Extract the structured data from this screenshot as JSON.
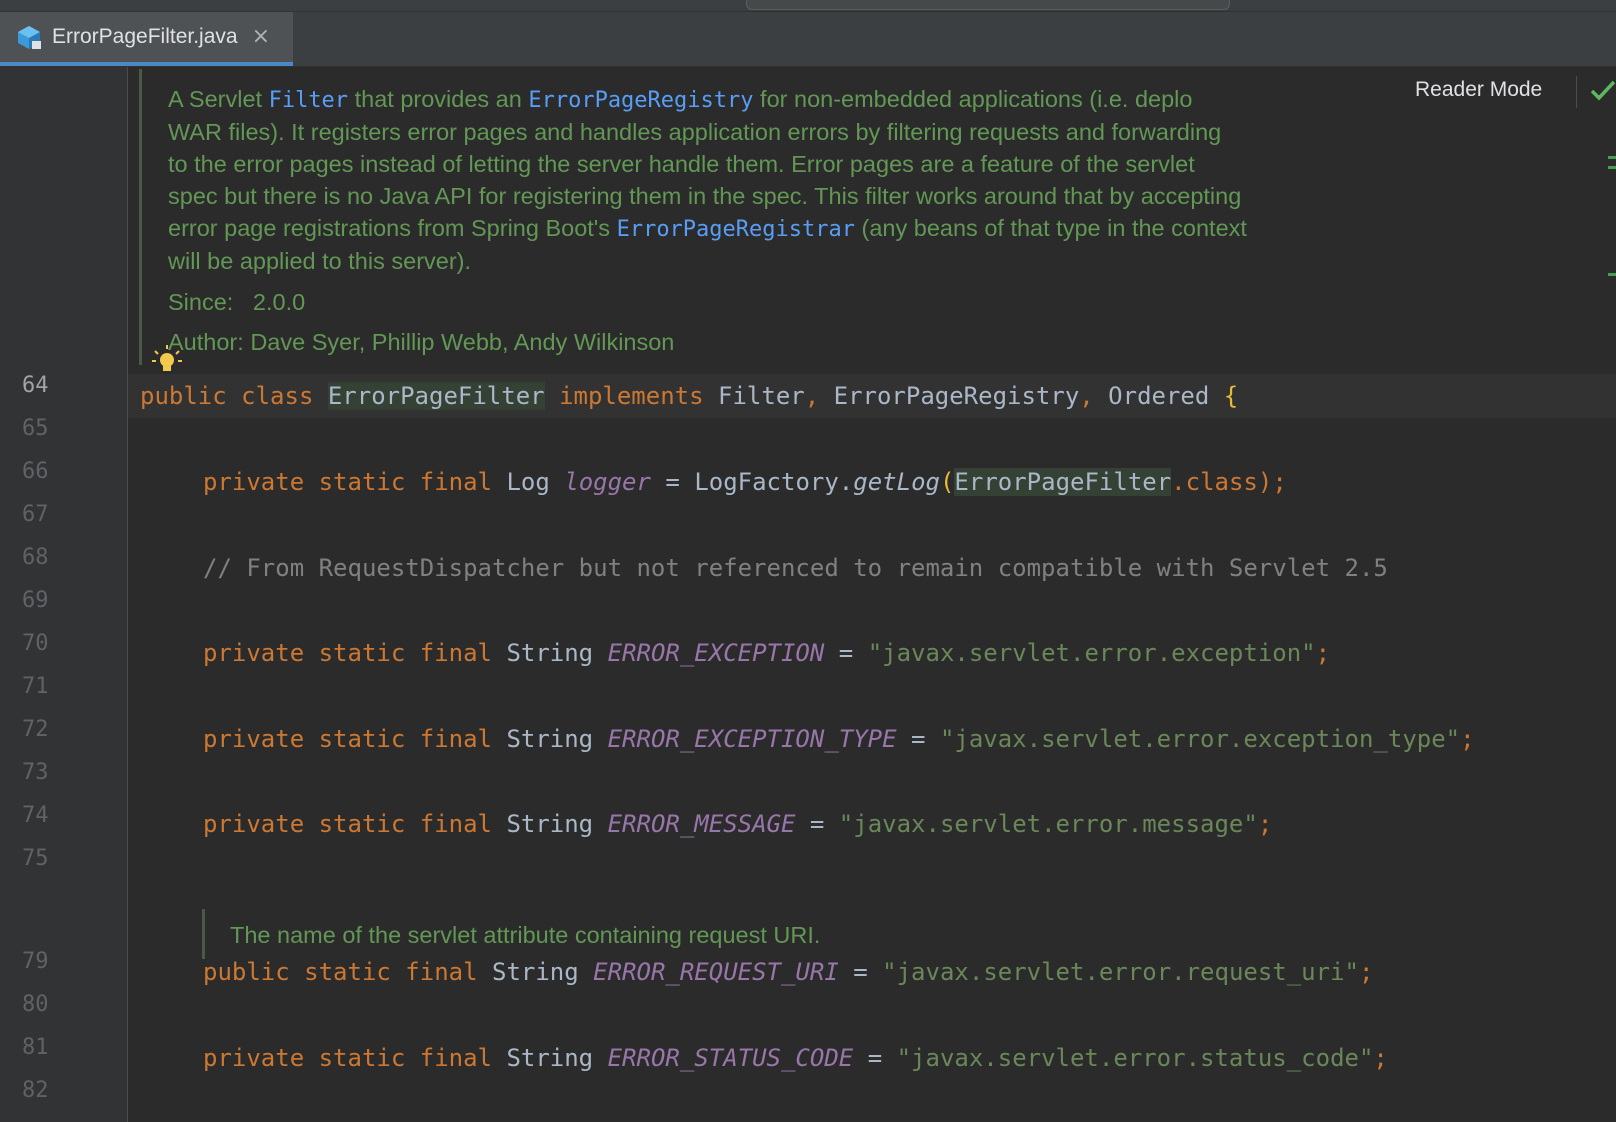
{
  "tab": {
    "title": "ErrorPageFilter.java",
    "close_label": "×",
    "icon": "java-class-file-icon"
  },
  "toolbar": {
    "reader_mode_label": "Reader Mode",
    "status_icon": "check-icon"
  },
  "doc_comment": {
    "text_1a": "A Servlet ",
    "link_filter": "Filter",
    "text_1b": " that provides an ",
    "link_registry": "ErrorPageRegistry",
    "text_1c": " for non-embedded applications (i.e. deplo",
    "line2": "WAR files). It registers error pages and handles application errors by filtering requests and forwarding",
    "line3": "to the error pages instead of letting the server handle them. Error pages are a feature of the servlet",
    "line4": "spec but there is no Java API for registering them in the spec. This filter works around that by accepting",
    "text_5a": "error page registrations from Spring Boot's ",
    "link_registrar": "ErrorPageRegistrar",
    "text_5b": " (any beans of that type in the context",
    "line6": "will be applied to this server).",
    "since_label": "Since:",
    "since_value": "2.0.0",
    "author_label": "Author:",
    "author_value": "Dave Syer, Phillip Webb, Andy Wilkinson"
  },
  "doc_comment_2": {
    "text": "The name of the servlet attribute containing request URI."
  },
  "line_numbers": [
    "64",
    "65",
    "66",
    "67",
    "68",
    "69",
    "70",
    "71",
    "72",
    "73",
    "74",
    "75",
    "79",
    "80",
    "81",
    "82"
  ],
  "code": {
    "l64": {
      "kw_public": "public",
      "kw_class": "class",
      "class_name": "ErrorPageFilter",
      "kw_implements": "implements",
      "iface1": "Filter",
      "comma1": ",",
      "iface2": "ErrorPageRegistry",
      "comma2": ",",
      "iface3": "Ordered",
      "brace": "{"
    },
    "l66": {
      "mods": "private static final",
      "type": "Log",
      "field": "logger",
      "eq": "=",
      "call_owner": "LogFactory.",
      "method": "getLog",
      "paren": "(",
      "arg": "ErrorPageFilter",
      "tail": ".class);"
    },
    "l68": {
      "comment": "// From RequestDispatcher but not referenced to remain compatible with Servlet 2.5"
    },
    "l70": {
      "mods": "private static final",
      "type": "String",
      "field": "ERROR_EXCEPTION",
      "eq": "=",
      "value": "\"javax.servlet.error.exception\"",
      "semi": ";"
    },
    "l72": {
      "mods": "private static final",
      "type": "String",
      "field": "ERROR_EXCEPTION_TYPE",
      "eq": "=",
      "value": "\"javax.servlet.error.exception_type\"",
      "semi": ";"
    },
    "l74": {
      "mods": "private static final",
      "type": "String",
      "field": "ERROR_MESSAGE",
      "eq": "=",
      "value": "\"javax.servlet.error.message\"",
      "semi": ";"
    },
    "l79": {
      "mods": "public static final",
      "type": "String",
      "field": "ERROR_REQUEST_URI",
      "eq": "=",
      "value": "\"javax.servlet.error.request_uri\"",
      "semi": ";"
    },
    "l81": {
      "mods": "private static final",
      "type": "String",
      "field": "ERROR_STATUS_CODE",
      "eq": "=",
      "value": "\"javax.servlet.error.status_code\"",
      "semi": ";"
    }
  },
  "colors": {
    "keyword": "#cc7832",
    "field": "#9876aa",
    "string": "#6a8759",
    "comment": "#808080",
    "doc": "#629755",
    "doc_link": "#589df6",
    "accent": "#4a88c7"
  }
}
